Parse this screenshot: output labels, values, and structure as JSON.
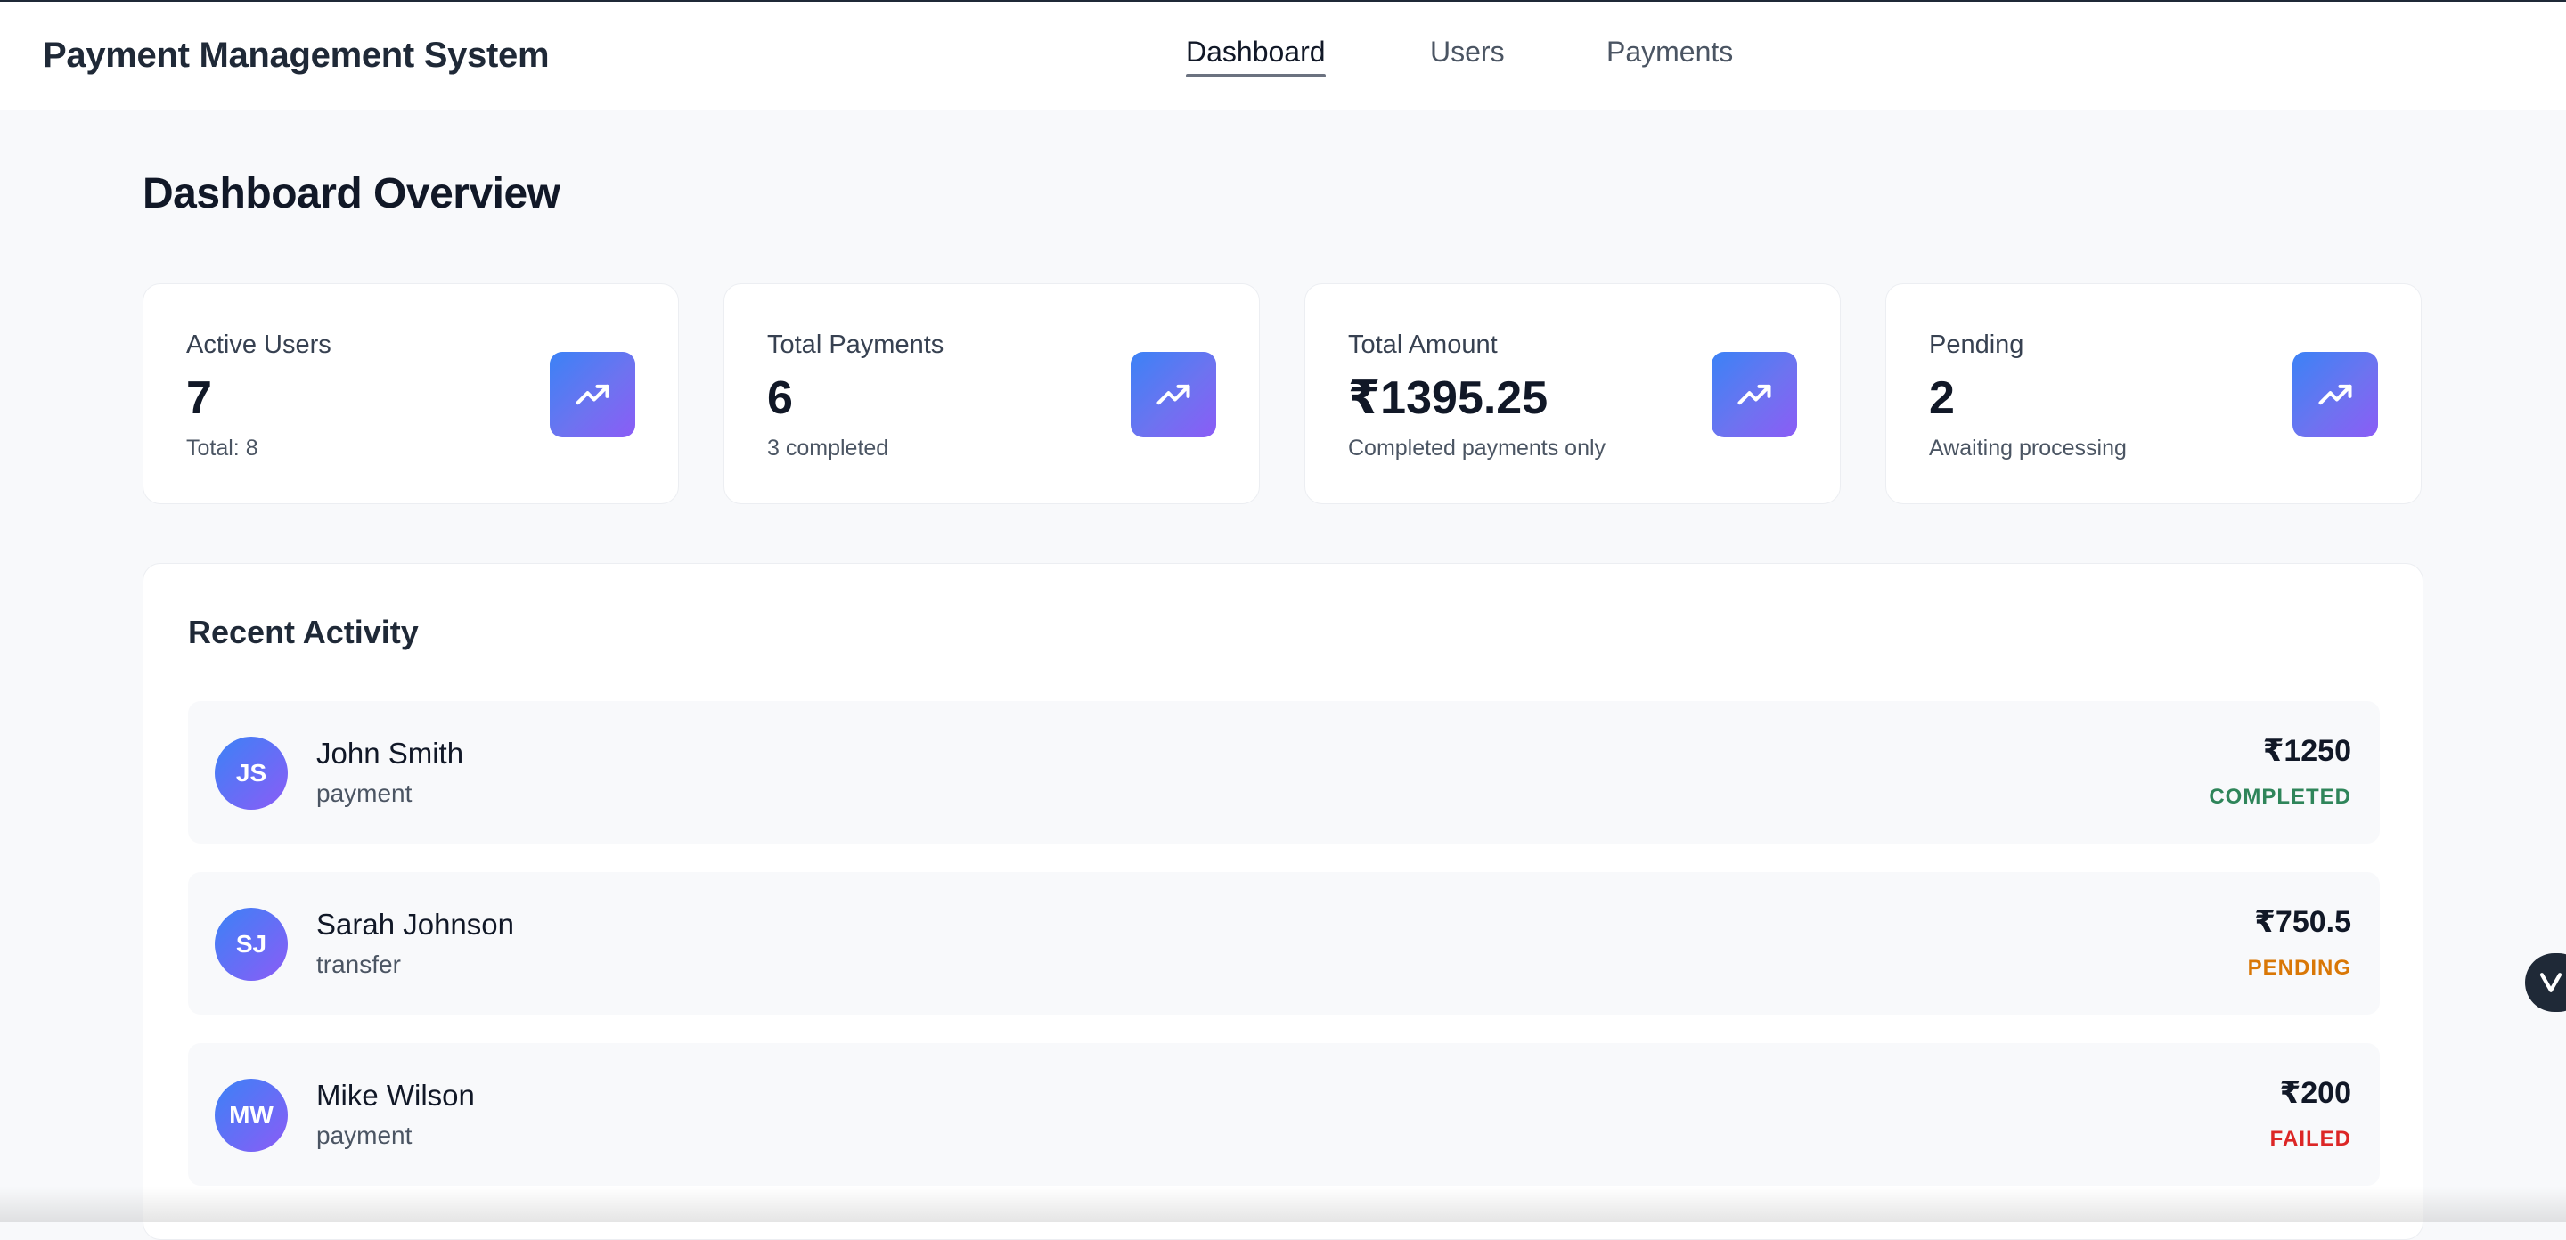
{
  "app": {
    "title": "Payment Management System"
  },
  "nav": {
    "items": [
      {
        "label": "Dashboard",
        "active": true
      },
      {
        "label": "Users",
        "active": false
      },
      {
        "label": "Payments",
        "active": false
      }
    ]
  },
  "page": {
    "title": "Dashboard Overview"
  },
  "stats": [
    {
      "label": "Active Users",
      "value": "7",
      "sub": "Total: 8",
      "icon": "trending-up-icon"
    },
    {
      "label": "Total Payments",
      "value": "6",
      "sub": "3 completed",
      "icon": "trending-up-icon"
    },
    {
      "label": "Total Amount",
      "value": "₹1395.25",
      "sub": "Completed payments only",
      "icon": "trending-up-icon"
    },
    {
      "label": "Pending",
      "value": "2",
      "sub": "Awaiting processing",
      "icon": "trending-up-icon"
    }
  ],
  "activity": {
    "title": "Recent Activity",
    "items": [
      {
        "initials": "JS",
        "name": "John Smith",
        "type": "payment",
        "amount": "₹1250",
        "status": "COMPLETED",
        "status_color": "#2f855a"
      },
      {
        "initials": "SJ",
        "name": "Sarah Johnson",
        "type": "transfer",
        "amount": "₹750.5",
        "status": "PENDING",
        "status_color": "#d97706"
      },
      {
        "initials": "MW",
        "name": "Mike Wilson",
        "type": "payment",
        "amount": "₹200",
        "status": "FAILED",
        "status_color": "#dc2626"
      }
    ]
  },
  "colors": {
    "accent_gradient_start": "#3b82f6",
    "accent_gradient_end": "#8b5cf6"
  }
}
